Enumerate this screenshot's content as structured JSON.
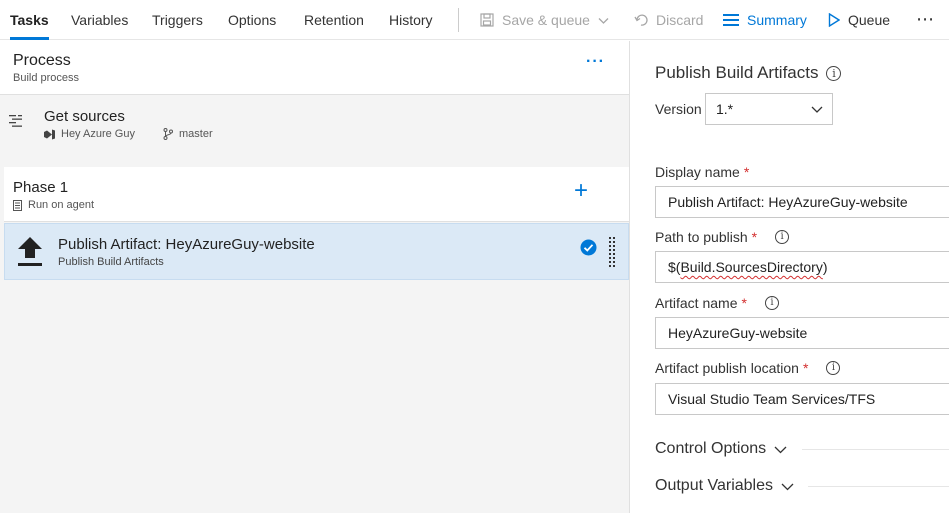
{
  "toolbar": {
    "tabs": [
      "Tasks",
      "Variables",
      "Triggers",
      "Options",
      "Retention",
      "History"
    ],
    "save_queue_label": "Save & queue",
    "discard_label": "Discard",
    "summary_label": "Summary",
    "queue_label": "Queue",
    "more_label": "⋯",
    "accent_color": "#0078d7"
  },
  "process": {
    "title": "Process",
    "subtitle": "Build process",
    "more_label": "···"
  },
  "get_sources": {
    "title": "Get sources",
    "repo": "Hey Azure Guy",
    "branch": "master"
  },
  "phase": {
    "title": "Phase 1",
    "subtitle": "Run on agent",
    "add_label": "+"
  },
  "task": {
    "title": "Publish Artifact: HeyAzureGuy-website",
    "subtitle": "Publish Build Artifacts",
    "icon": "upload-icon",
    "selected_bg": "#dbe9f6"
  },
  "details": {
    "title": "Publish Build Artifacts",
    "version_label": "Version",
    "version_value": "1.*",
    "fields": [
      {
        "label": "Display name",
        "required": "*",
        "value": "Publish Artifact: HeyAzureGuy-website"
      },
      {
        "label": "Path to publish",
        "required": "*",
        "value_prefix": "$(",
        "value_underlined": "Build.SourcesDirectory",
        "value_suffix": ")"
      },
      {
        "label": "Artifact name",
        "required": "*",
        "value": "HeyAzureGuy-website"
      },
      {
        "label": "Artifact publish location",
        "required": "*",
        "value": "Visual Studio Team Services/TFS"
      }
    ],
    "sections": [
      "Control Options",
      "Output Variables"
    ]
  }
}
